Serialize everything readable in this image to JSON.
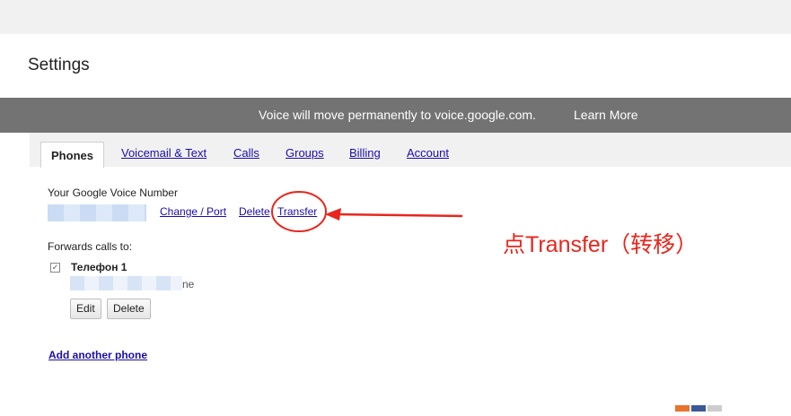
{
  "page": {
    "title": "Settings"
  },
  "banner": {
    "message": "Voice will move permanently to voice.google.com.",
    "learn_more": "Learn More"
  },
  "tabs": [
    {
      "label": "Phones",
      "active": true
    },
    {
      "label": "Voicemail & Text"
    },
    {
      "label": "Calls"
    },
    {
      "label": "Groups"
    },
    {
      "label": "Billing"
    },
    {
      "label": "Account"
    }
  ],
  "gv_number": {
    "label": "Your Google Voice Number",
    "actions": {
      "change_port": "Change / Port",
      "delete": "Delete",
      "transfer": "Transfer"
    }
  },
  "forwards": {
    "label": "Forwards calls to:",
    "phone_name": "Телефон 1",
    "checkbox_glyph": "✓",
    "phone_suffix": "ne",
    "edit": "Edit",
    "delete": "Delete"
  },
  "add_phone": "Add another phone",
  "annotation": {
    "text": "点Transfer（转移）",
    "color": "#e8261d"
  },
  "colors": {
    "banner_bg": "#737373",
    "link": "#1a0dab",
    "tab_bg": "#f1f1f1",
    "footer_orange": "#e8732b",
    "footer_blue": "#3b5998",
    "footer_gray": "#cccccc"
  }
}
